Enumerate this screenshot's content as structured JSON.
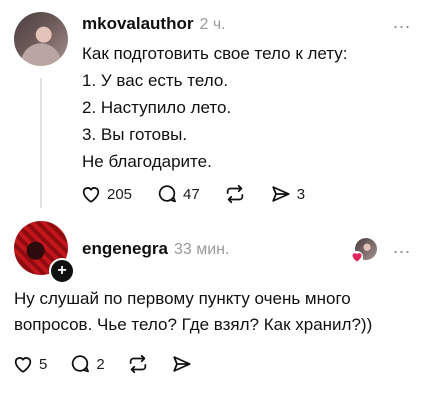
{
  "post": {
    "username": "mkovalauthor",
    "time": "2 ч.",
    "more": "...",
    "lines": [
      "Как подготовить свое тело к лету:",
      "1. У вас есть тело.",
      "2. Наступило лето.",
      "3. Вы готовы.",
      "Не благодарите."
    ],
    "likes": "205",
    "replies": "47",
    "shares": "3"
  },
  "reply": {
    "username": "engenegra",
    "time": "33 мин.",
    "more": "...",
    "text_lines": [
      "Ну слушай по первому пункту очень много",
      "вопросов. Чье тело? Где взял? Как хранил?))"
    ],
    "likes": "5",
    "replies": "2"
  },
  "icons": {
    "like": "heart-icon",
    "reply": "comment-icon",
    "repost": "repost-icon",
    "share": "send-icon",
    "follow": "plus-icon"
  },
  "colors": {
    "text": "#101010",
    "muted": "#9a9a9a",
    "like_red": "#e0245e"
  }
}
